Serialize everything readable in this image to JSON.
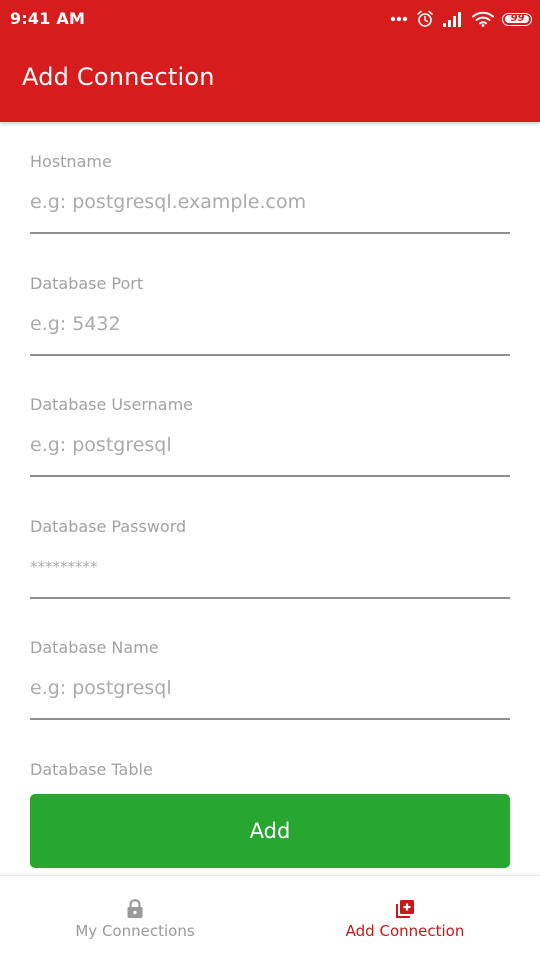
{
  "status_bar": {
    "time": "9:41 AM",
    "battery": "99",
    "battery_level": 0.99,
    "icons": [
      "more-dots-icon",
      "alarm-icon",
      "signal-icon",
      "wifi-icon",
      "battery-icon"
    ]
  },
  "app_bar": {
    "title": "Add Connection"
  },
  "form": {
    "fields": [
      {
        "label": "Hostname",
        "placeholder": "e.g: postgresql.example.com",
        "value": ""
      },
      {
        "label": "Database Port",
        "placeholder": "e.g: 5432",
        "value": ""
      },
      {
        "label": "Database Username",
        "placeholder": "e.g: postgresql",
        "value": ""
      },
      {
        "label": "Database Password",
        "placeholder": "*********",
        "value": ""
      },
      {
        "label": "Database Name",
        "placeholder": "e.g: postgresql",
        "value": ""
      },
      {
        "label": "Database Table"
      }
    ],
    "submit_label": "Add"
  },
  "bottom_nav": {
    "items": [
      {
        "label": "My Connections",
        "icon": "lock-icon",
        "active": false
      },
      {
        "label": "Add Connection",
        "icon": "add-box-icon",
        "active": true
      }
    ]
  },
  "colors": {
    "primary": "#d71c1e",
    "accent_active": "#c7191b",
    "button": "#27a730",
    "label": "#a2a2a2",
    "inactive": "#9a9a9a"
  }
}
